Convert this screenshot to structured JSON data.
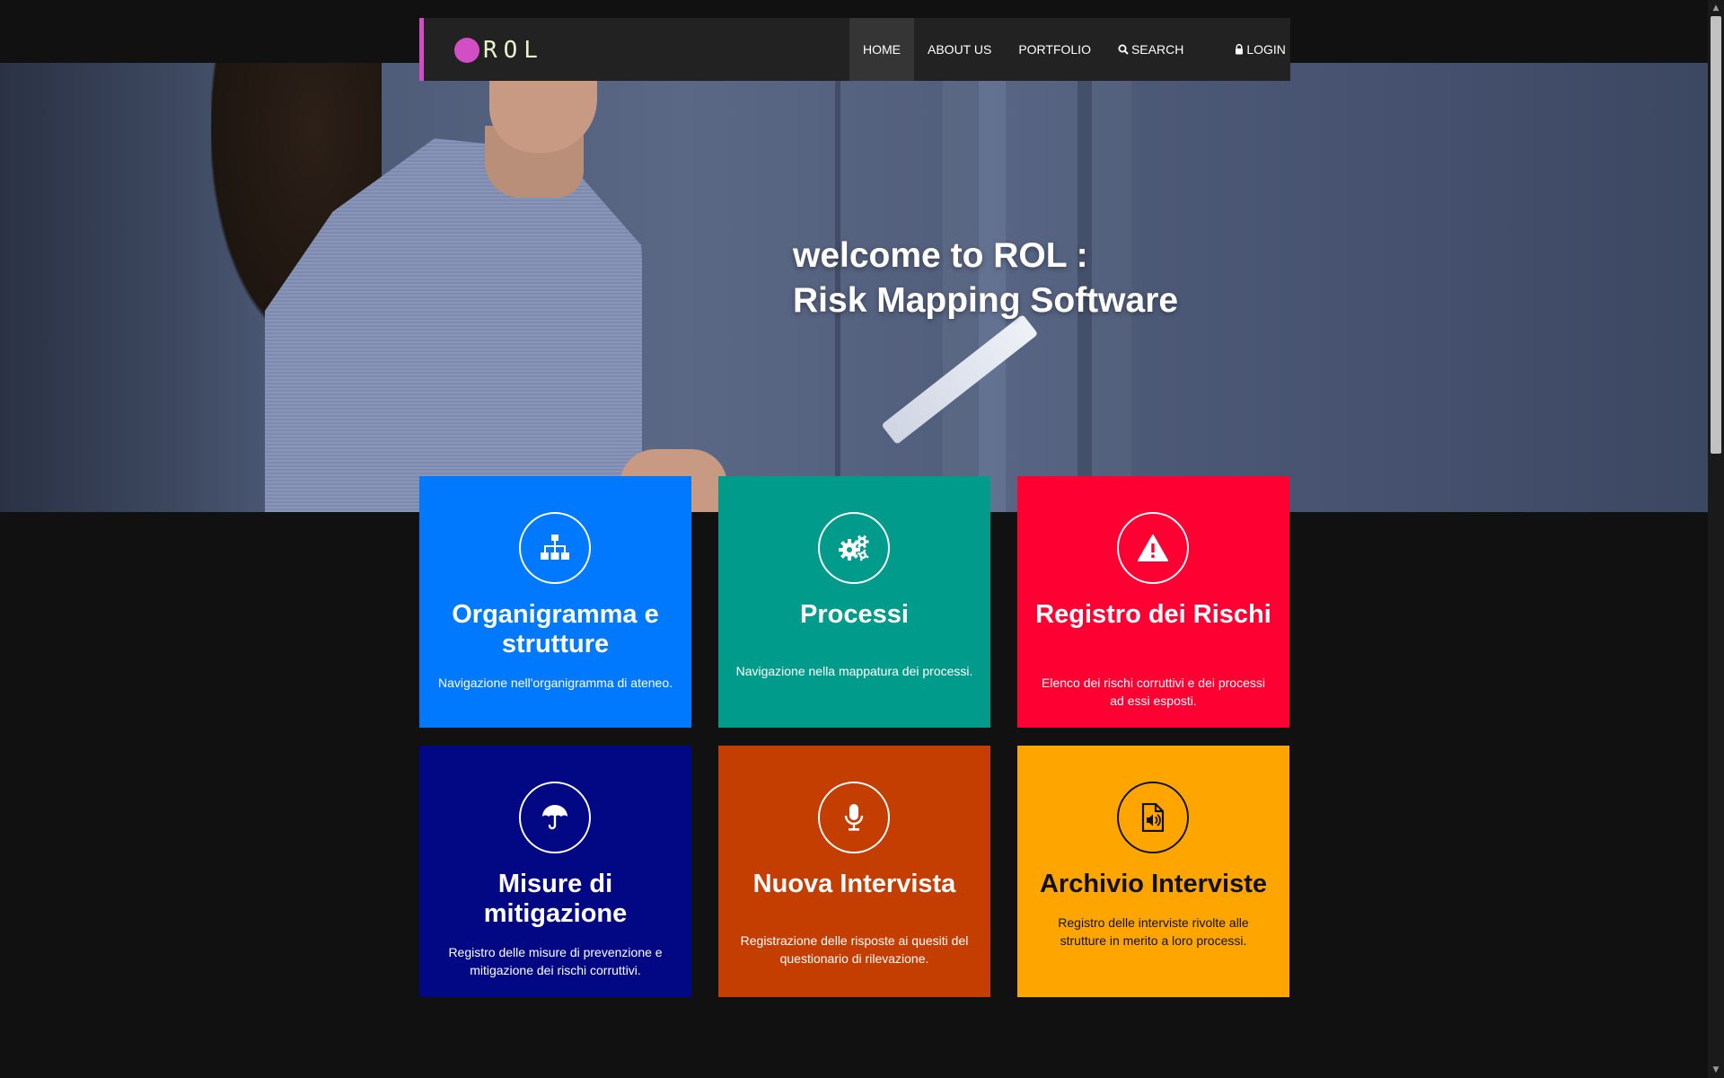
{
  "brand": {
    "logo_text": "ROL",
    "accent_color": "#d34ec5"
  },
  "nav": {
    "items": [
      {
        "label": "HOME",
        "active": true
      },
      {
        "label": "ABOUT US"
      },
      {
        "label": "PORTFOLIO"
      },
      {
        "label": "SEARCH",
        "icon": "search-icon"
      },
      {
        "label": "LOGIN",
        "icon": "lock-icon"
      }
    ]
  },
  "hero": {
    "title_line1": "welcome to ROL :",
    "title_line2": "Risk Mapping Software"
  },
  "cards": [
    {
      "title": "Organigramma e strutture",
      "desc": "Navigazione nell'organigramma di ateneo.",
      "icon": "sitemap-icon",
      "color": "#0179fe"
    },
    {
      "title": "Processi",
      "desc": "Navigazione nella mappatura dei processi.",
      "icon": "gears-icon",
      "color": "#009b8a"
    },
    {
      "title": "Registro dei Rischi",
      "desc": "Elenco dei rischi corruttivi e dei processi ad essi esposti.",
      "icon": "warning-icon",
      "color": "#ff0033"
    },
    {
      "title": "Misure di mitigazione",
      "desc": "Registro delle misure di prevenzione e mitigazione dei rischi corruttivi.",
      "icon": "umbrella-icon",
      "color": "#020883"
    },
    {
      "title": "Nuova Intervista",
      "desc": "Registrazione delle risposte ai quesiti del questionario di rilevazione.",
      "icon": "microphone-icon",
      "color": "#c43e02"
    },
    {
      "title": "Archivio Interviste",
      "desc": "Registro delle interviste rivolte alle strutture in merito a loro processi.",
      "icon": "audio-file-icon",
      "color": "#ffa500"
    }
  ]
}
